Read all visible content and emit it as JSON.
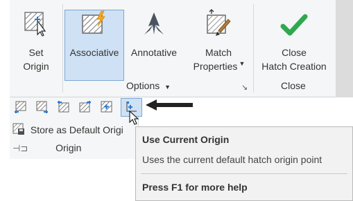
{
  "ribbon": {
    "buttons": {
      "set_origin": {
        "line1": "Set",
        "line2": "Origin"
      },
      "associative": {
        "label": "Associative"
      },
      "annotative": {
        "label": "Annotative"
      },
      "match_properties": {
        "line1": "Match",
        "line2": "Properties"
      },
      "close_hatch": {
        "line1": "Close",
        "line2": "Hatch Creation"
      }
    },
    "panels": {
      "options_title": "Options",
      "close_title": "Close",
      "origin_title": "Origin"
    },
    "origin_panel": {
      "store_default_label": "Store as Default Origi",
      "selected_tool_index": 5
    }
  },
  "tooltip": {
    "title": "Use Current Origin",
    "description": "Uses the current default hatch origin point",
    "help": "Press F1 for more help"
  },
  "colors": {
    "selected_bg": "#cfe1f4",
    "selected_border": "#7aa6d6",
    "close_check": "#2fa84f",
    "annotate_icon": "#4a5560",
    "accent_orange": "#f5a623"
  },
  "icons": {
    "set_origin": "hatch-origin-cursor-icon",
    "associative": "associative-hatch-icon",
    "annotative": "annotative-scale-icon",
    "match_properties": "match-properties-brush-icon",
    "close": "green-checkmark-icon",
    "pointer": "black-arrow-icon"
  }
}
